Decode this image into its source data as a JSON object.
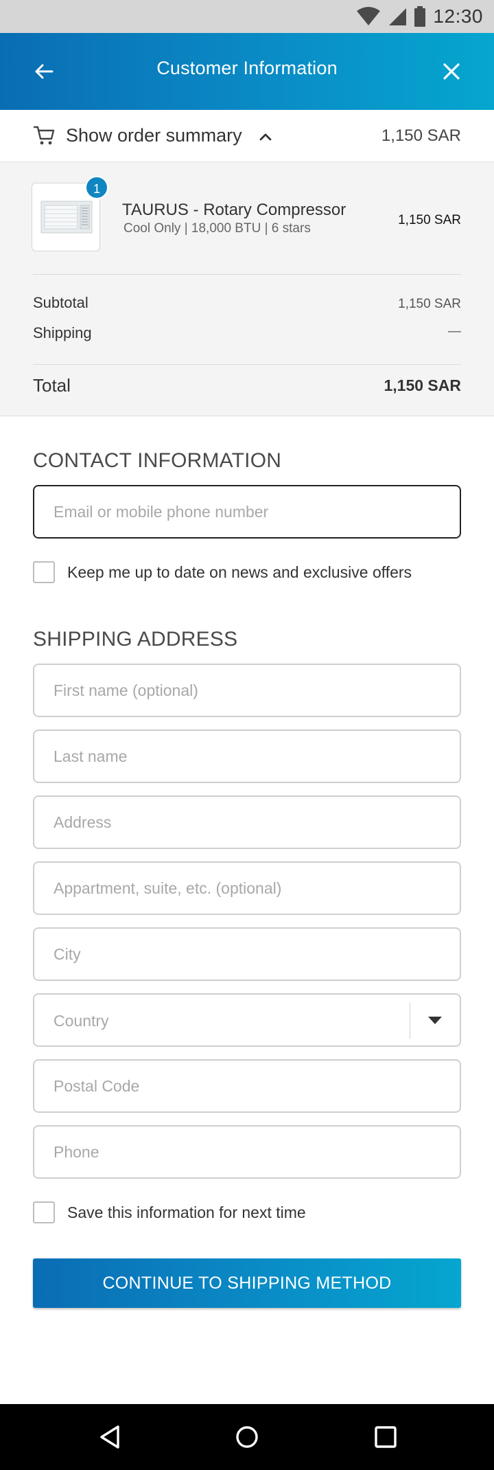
{
  "status_bar": {
    "time": "12:30"
  },
  "app_bar": {
    "title": "Customer Information"
  },
  "summary_toggle": {
    "label": "Show order summary",
    "amount": "1,150 SAR"
  },
  "order": {
    "item": {
      "quantity": "1",
      "name": "TAURUS - Rotary Compressor",
      "meta": "Cool Only | 18,000 BTU | 6 stars",
      "price": "1,150 SAR"
    },
    "subtotal_label": "Subtotal",
    "subtotal_value": "1,150 SAR",
    "shipping_label": "Shipping",
    "shipping_value": "—",
    "total_label": "Total",
    "total_value": "1,150 SAR"
  },
  "contact": {
    "title": "CONTACT INFORMATION",
    "email_placeholder": "Email or mobile phone number",
    "newsletter_label": "Keep me up to date on news and exclusive offers"
  },
  "shipping": {
    "title": "SHIPPING ADDRESS",
    "first_name_placeholder": "First name (optional)",
    "last_name_placeholder": "Last name",
    "address_placeholder": "Address",
    "apartment_placeholder": "Appartment, suite, etc. (optional)",
    "city_placeholder": "City",
    "country_placeholder": "Country",
    "postal_placeholder": "Postal Code",
    "phone_placeholder": "Phone",
    "save_info_label": "Save this information for next time"
  },
  "cta_label": "CONTINUE TO SHIPPING METHOD",
  "colors": {
    "accent_start": "#0a6db4",
    "accent_end": "#05a6cf",
    "badge": "#0f86c1"
  }
}
